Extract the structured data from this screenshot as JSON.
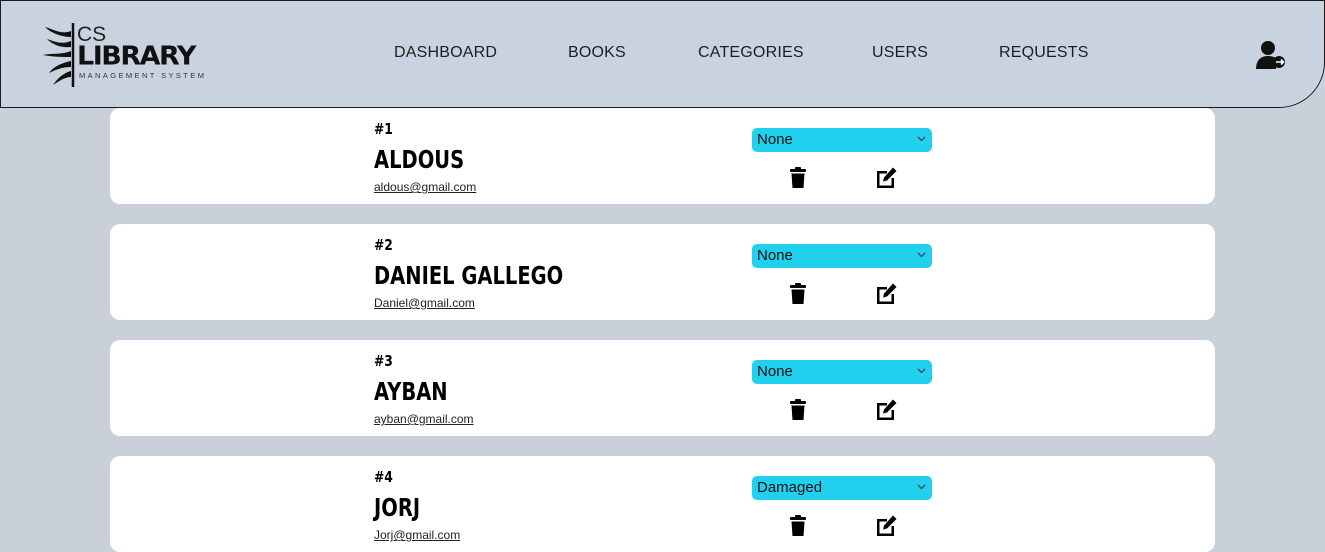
{
  "header": {
    "logo": {
      "cs": "CS",
      "library": "LIBRARY",
      "subtitle": "MANAGEMENT SYSTEM"
    },
    "nav": [
      "DASHBOARD",
      "BOOKS",
      "CATEGORIES",
      "USERS",
      "REQUESTS"
    ],
    "user_icon": "user-logout-icon"
  },
  "users": [
    {
      "number": "#1",
      "name": "ALDOUS",
      "email": "aldous@gmail.com",
      "status": "None"
    },
    {
      "number": "#2",
      "name": "DANIEL GALLEGO",
      "email": "Daniel@gmail.com",
      "status": "None"
    },
    {
      "number": "#3",
      "name": "AYBAN",
      "email": "ayban@gmail.com",
      "status": "None"
    },
    {
      "number": "#4",
      "name": "JORJ",
      "email": "Jorj@gmail.com",
      "status": "Damaged"
    }
  ],
  "icons": {
    "delete": "trash-icon",
    "edit": "edit-icon"
  },
  "colors": {
    "background": "#c9d0da",
    "header": "#c9d3df",
    "select": "#21d0ec",
    "card": "#ffffff"
  }
}
